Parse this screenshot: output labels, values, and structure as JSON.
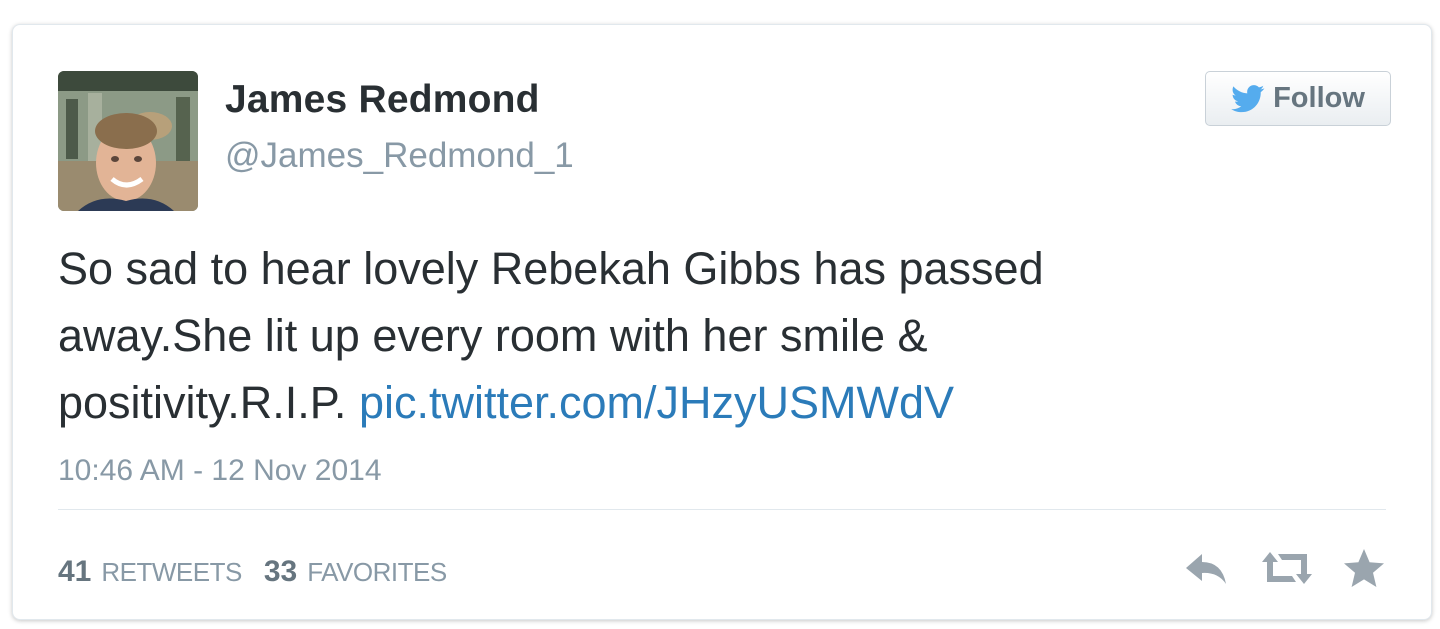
{
  "tweet": {
    "author": {
      "name": "James Redmond",
      "handle": "@James_Redmond_1"
    },
    "follow_label": "Follow",
    "text_lines": [
      "So sad to hear lovely Rebekah Gibbs has passed",
      "away.She lit up every room with her smile &",
      "positivity.R.I.P. "
    ],
    "link_text": "pic.twitter.com/JHzyUSMWdV",
    "timestamp": "10:46 AM - 12 Nov 2014",
    "stats": {
      "retweets_count": "41",
      "retweets_label": "RETWEETS",
      "favorites_count": "33",
      "favorites_label": "FAVORITES"
    },
    "icons": {
      "follow": "twitter-bird-icon",
      "reply": "reply-icon",
      "retweet": "retweet-icon",
      "favorite": "star-icon"
    }
  },
  "colors": {
    "link": "#2b7bb9",
    "bird": "#55acee",
    "text": "#292f33",
    "muted": "#8899a6",
    "action_icons": "#9aa5ae"
  }
}
